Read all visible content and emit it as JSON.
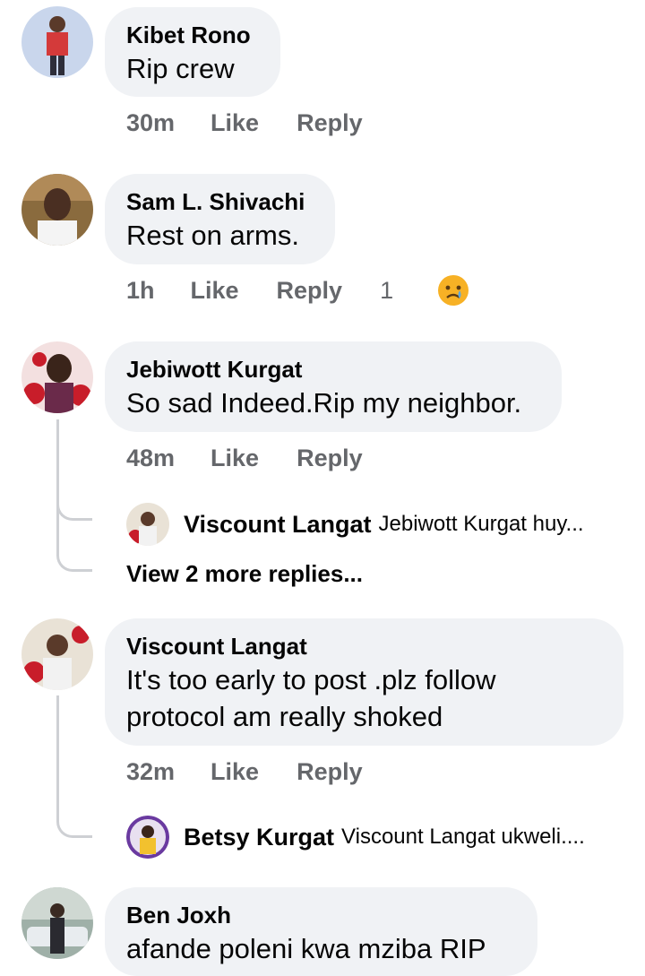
{
  "comments": [
    {
      "author": "Kibet Rono",
      "text": "Rip crew",
      "time": "30m",
      "like": "Like",
      "reply": "Reply"
    },
    {
      "author": "Sam L. Shivachi",
      "text": "Rest on arms.",
      "time": "1h",
      "like": "Like",
      "reply": "Reply",
      "reaction_count": "1",
      "reaction_icon": "sad-face-emoji"
    },
    {
      "author": "Jebiwott Kurgat",
      "text": "So sad Indeed.Rip my neighbor.",
      "time": "48m",
      "like": "Like",
      "reply": "Reply",
      "reply_preview": {
        "author": "Viscount Langat",
        "text": "Jebiwott Kurgat huy..."
      },
      "view_more": "View 2 more replies..."
    },
    {
      "author": "Viscount Langat",
      "text_line1": "It's too early to post .plz follow",
      "text_line2": "protocol am really shoked",
      "time": "32m",
      "like": "Like",
      "reply": "Reply",
      "reply_preview": {
        "author": "Betsy Kurgat",
        "text": "Viscount Langat ukweli...."
      }
    },
    {
      "author": "Ben Joxh",
      "text": "afande poleni kwa mziba RIP"
    }
  ],
  "colors": {
    "bubble": "#f0f2f5",
    "meta_text": "#65676b",
    "thread_line": "#ced0d4",
    "emoji": "#f7b125"
  }
}
